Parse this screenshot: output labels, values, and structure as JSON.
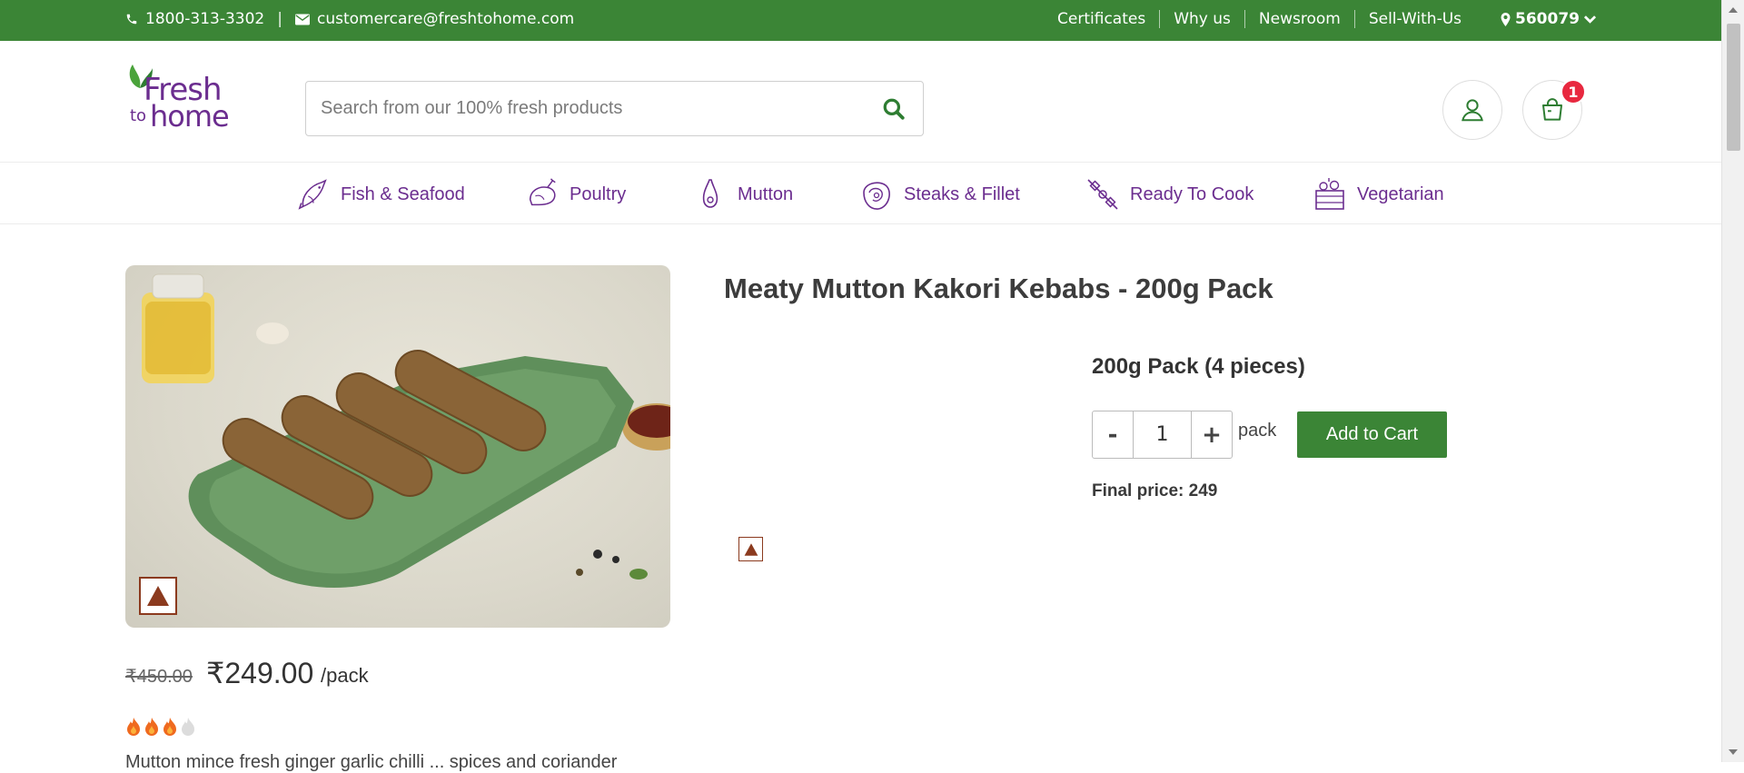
{
  "topbar": {
    "phone": "1800-313-3302",
    "divider": "|",
    "email": "customercare@freshtohome.com",
    "links": [
      "Certificates",
      "Why us",
      "Newsroom",
      "Sell-With-Us"
    ],
    "pincode": "560079"
  },
  "header": {
    "logo": {
      "fresh": "Fresh",
      "to": "to",
      "home": "home"
    },
    "search_placeholder": "Search from our 100% fresh products",
    "cart_count": "1"
  },
  "categories": [
    {
      "label": "Fish & Seafood",
      "icon": "fish-icon"
    },
    {
      "label": "Poultry",
      "icon": "chicken-icon"
    },
    {
      "label": "Mutton",
      "icon": "mutton-leg-icon"
    },
    {
      "label": "Steaks & Fillet",
      "icon": "steak-icon"
    },
    {
      "label": "Ready To Cook",
      "icon": "skewer-icon"
    },
    {
      "label": "Vegetarian",
      "icon": "vegetable-basket-icon"
    }
  ],
  "product": {
    "title": "Meaty Mutton Kakori Kebabs - 200g Pack",
    "variant": "200g Pack (4 pieces)",
    "quantity": "1",
    "qty_minus": "-",
    "qty_plus": "+",
    "unit": "pack",
    "add_to_cart": "Add to Cart",
    "final_price": "Final price: 249",
    "mrp": "₹450.00",
    "price": "₹249.00",
    "per_unit": "/pack",
    "spice_level": 3,
    "spice_max": 4,
    "description_partial": "Mutton mince fresh ginger garlic chilli ... spices and coriander"
  },
  "colors": {
    "brand_green": "#3b8536",
    "brand_purple": "#6b2d8f",
    "badge_red": "#e8283f",
    "nonveg_mark": "#8b3a1e"
  }
}
